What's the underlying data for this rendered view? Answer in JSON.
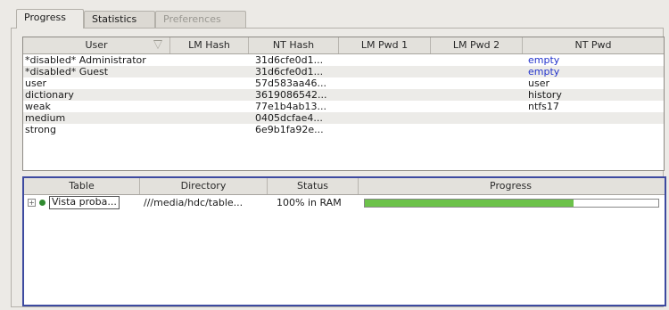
{
  "tabs": [
    {
      "label": "Progress",
      "state": "active"
    },
    {
      "label": "Statistics",
      "state": "normal"
    },
    {
      "label": "Preferences",
      "state": "disabled"
    }
  ],
  "users_table": {
    "columns": [
      "User",
      "LM Hash",
      "NT Hash",
      "LM Pwd 1",
      "LM Pwd 2",
      "NT Pwd"
    ],
    "rows": [
      {
        "user": "*disabled* Administrator",
        "lm_hash": "",
        "nt_hash": "31d6cfe0d1...",
        "lm_pwd1": "",
        "lm_pwd2": "",
        "nt_pwd": "empty"
      },
      {
        "user": "*disabled* Guest",
        "lm_hash": "",
        "nt_hash": "31d6cfe0d1...",
        "lm_pwd1": "",
        "lm_pwd2": "",
        "nt_pwd": "empty"
      },
      {
        "user": "user",
        "lm_hash": "",
        "nt_hash": "57d583aa46...",
        "lm_pwd1": "",
        "lm_pwd2": "",
        "nt_pwd": "user"
      },
      {
        "user": "dictionary",
        "lm_hash": "",
        "nt_hash": "3619086542...",
        "lm_pwd1": "",
        "lm_pwd2": "",
        "nt_pwd": "history"
      },
      {
        "user": "weak",
        "lm_hash": "",
        "nt_hash": "77e1b4ab13...",
        "lm_pwd1": "",
        "lm_pwd2": "",
        "nt_pwd": "ntfs17"
      },
      {
        "user": "medium",
        "lm_hash": "",
        "nt_hash": "0405dcfae4...",
        "lm_pwd1": "",
        "lm_pwd2": "",
        "nt_pwd": ""
      },
      {
        "user": "strong",
        "lm_hash": "",
        "nt_hash": "6e9b1fa92e...",
        "lm_pwd1": "",
        "lm_pwd2": "",
        "nt_pwd": ""
      }
    ]
  },
  "tables_table": {
    "columns": [
      "Table",
      "Directory",
      "Status",
      "Progress"
    ],
    "rows": [
      {
        "table": "Vista proba...",
        "directory": "///media/hdc/table...",
        "status": "100% in RAM",
        "progress": 0.71
      }
    ]
  },
  "colors": {
    "empty_pwd": "#2233cc",
    "progress_fill": "#6cc24a"
  }
}
